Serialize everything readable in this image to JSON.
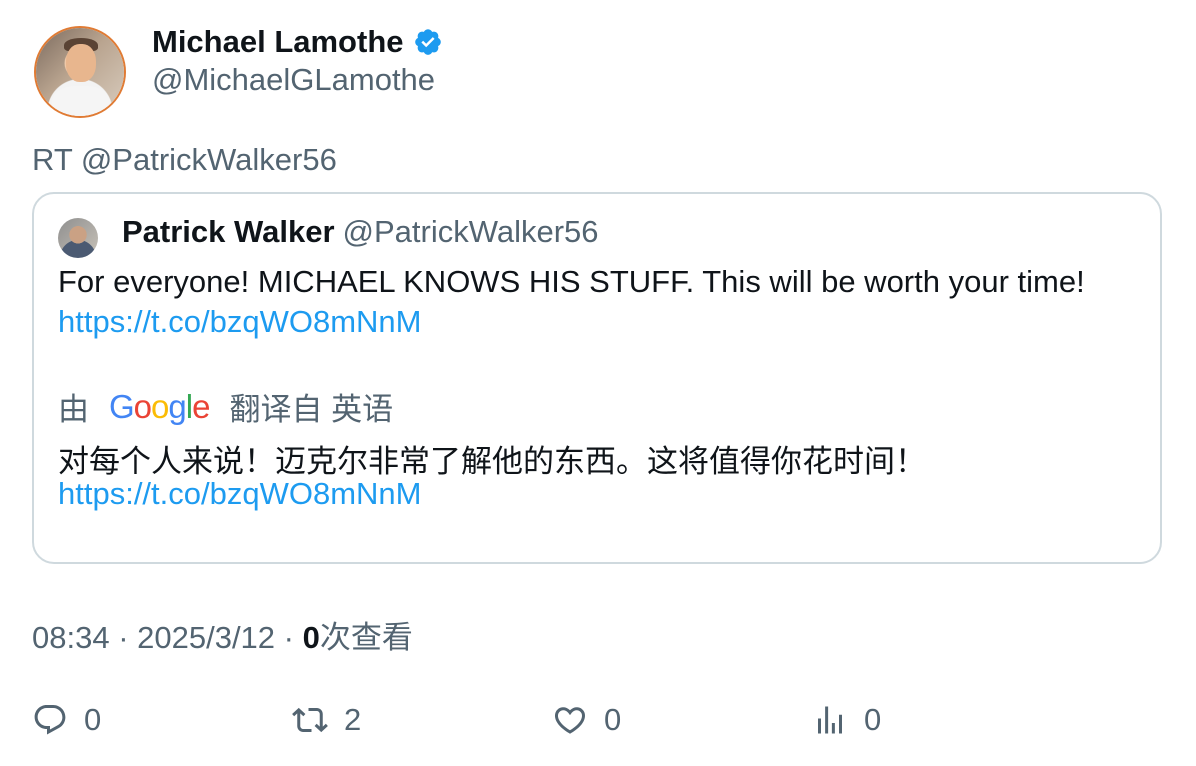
{
  "author": {
    "display_name": "Michael Lamothe",
    "handle": "@MichaelGLamothe",
    "verified": true
  },
  "retweet_line": "RT @PatrickWalker56",
  "quoted": {
    "display_name": "Patrick Walker",
    "handle": "@PatrickWalker56",
    "text": "For everyone! MICHAEL KNOWS HIS STUFF.   This will be worth your time!",
    "link": "https://t.co/bzqWO8mNnM",
    "translation": {
      "by_label": "由",
      "provider": "Google",
      "from_label": "翻译自 英语",
      "text": "对每个人来说！迈克尔非常了解他的东西。这将值得你花时间！",
      "link": "https://t.co/bzqWO8mNnM"
    }
  },
  "meta": {
    "time_date": "08:34 · 2025/3/12 · ",
    "views": "0",
    "views_label": "次查看"
  },
  "actions": {
    "reply_count": "0",
    "retweet_count": "2",
    "like_count": "0",
    "views_count": "0"
  },
  "colors": {
    "accent": "#1d9bf0",
    "secondary_text": "#536471",
    "border": "#cfd9de"
  },
  "icons": [
    "verified-badge-icon",
    "reply-icon",
    "retweet-icon",
    "like-icon",
    "views-icon"
  ]
}
